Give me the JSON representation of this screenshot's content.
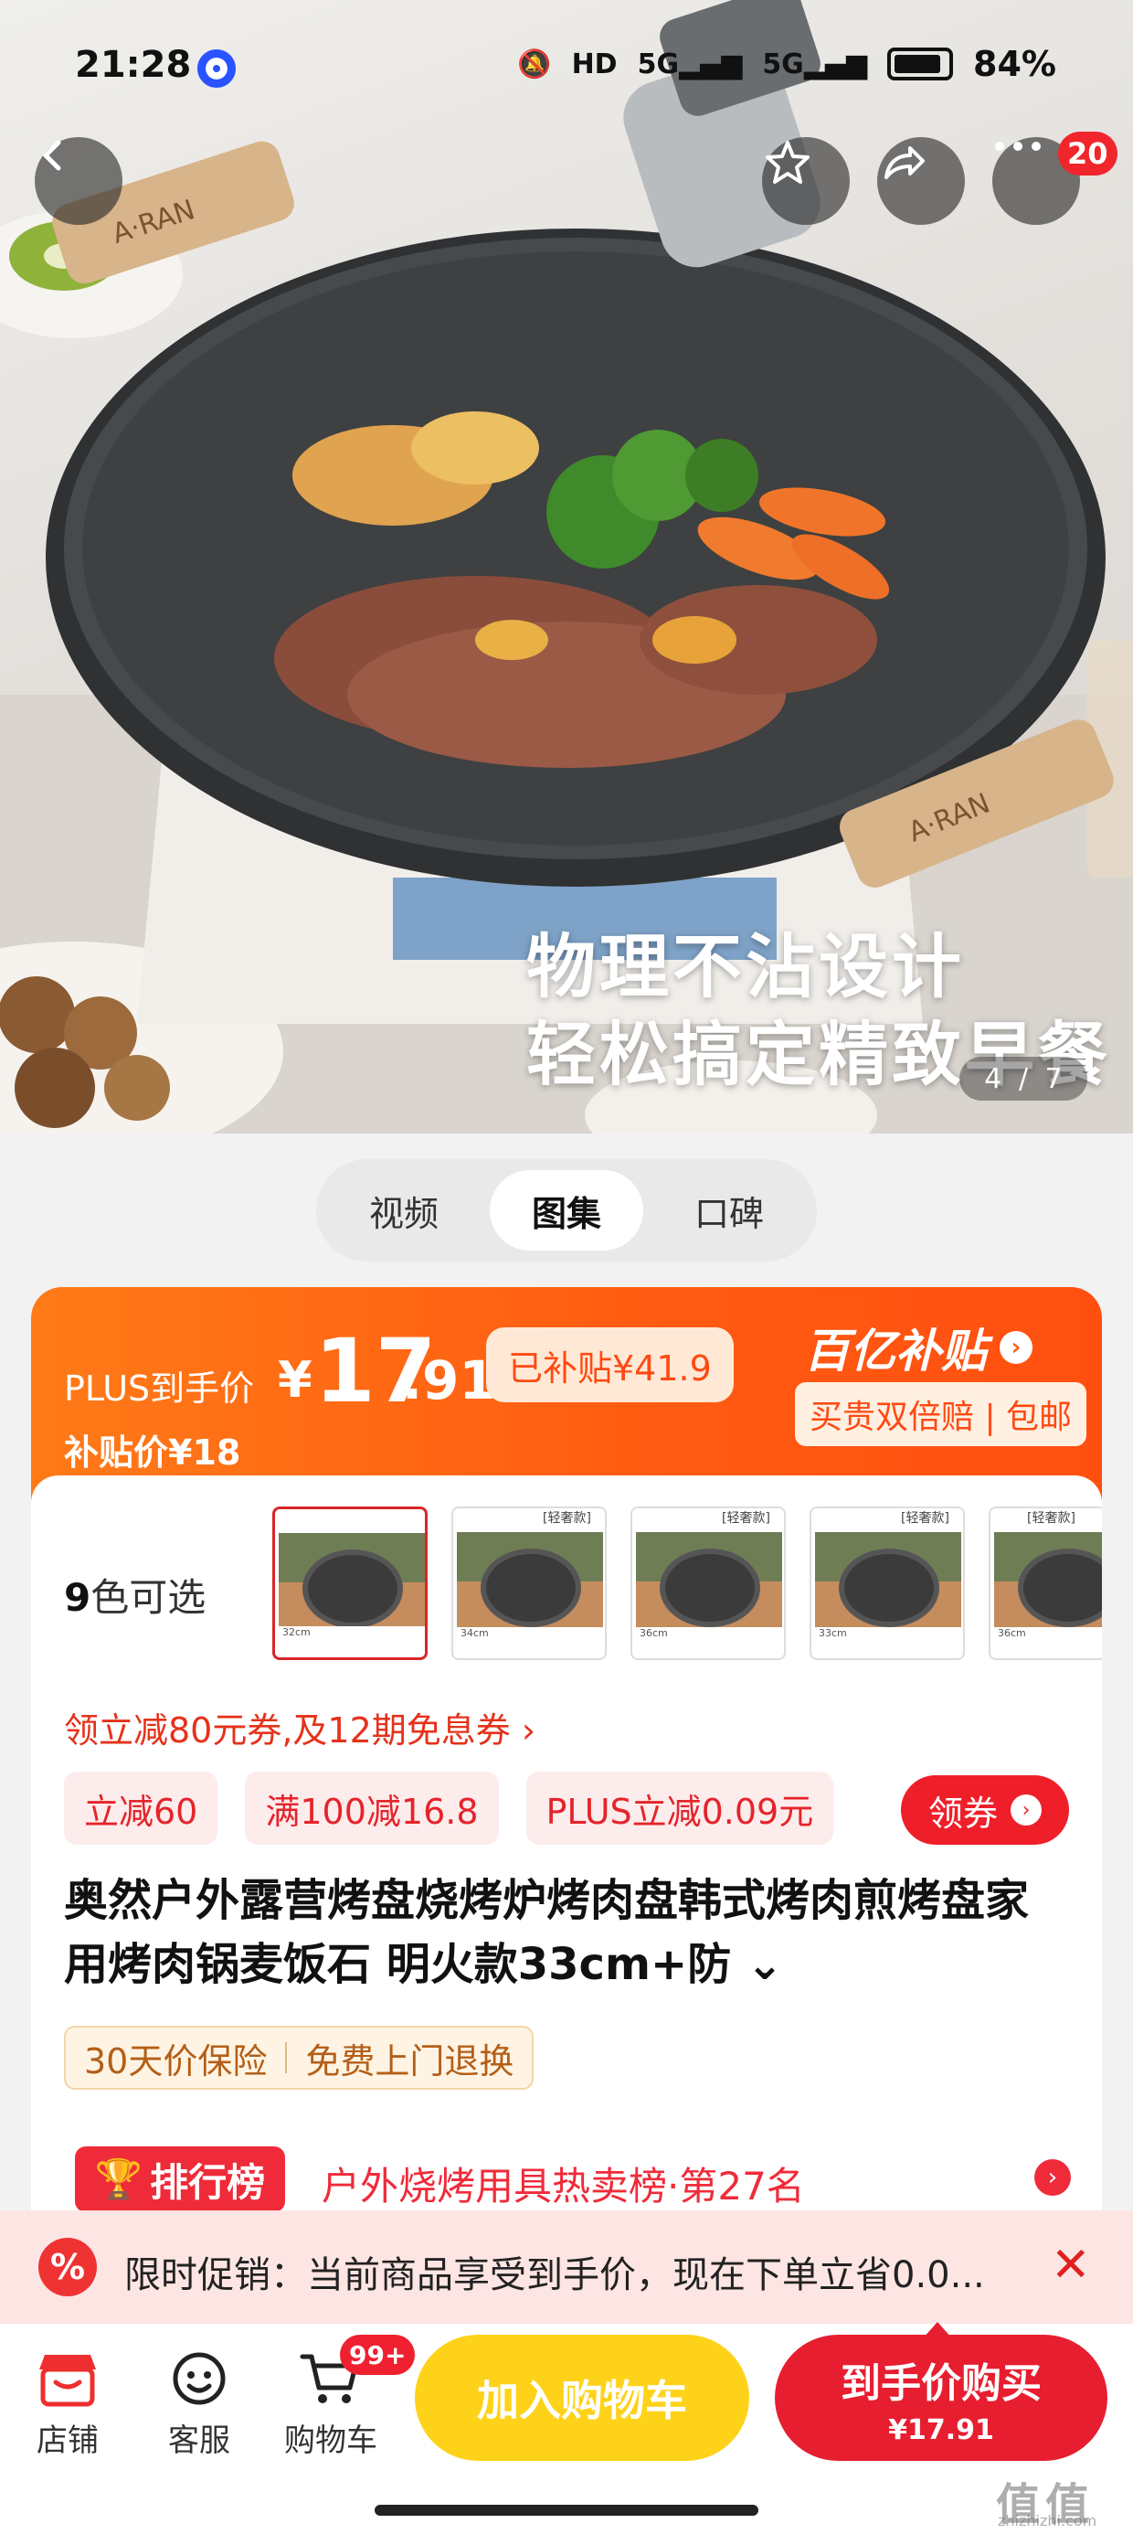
{
  "status_bar": {
    "time": "21:28",
    "hd": "HD",
    "net1": "5G",
    "net2": "5G",
    "battery": "84%"
  },
  "hero": {
    "caption_line1": "物理不沾设计",
    "caption_line2": "轻松搞定精致早餐",
    "brand_text": "A·RAN",
    "more_badge": "20",
    "page_current": "4",
    "page_total": "7"
  },
  "media_tabs": [
    "视频",
    "图集",
    "口碑"
  ],
  "price": {
    "plus_label": "PLUS到手价",
    "currency": "¥",
    "integer": "17",
    "decimal": ".91",
    "subsidy_chip": "已补贴¥41.9",
    "subsidy_price": "补贴价¥18",
    "yi_logo": "百亿补贴",
    "yi_sub": "买贵双倍赔 | 包邮"
  },
  "colors": {
    "count_num": "9",
    "count_label": "色可选",
    "swatch_tag": "[轻奢款]",
    "swatches": [
      "32cm",
      "34cm",
      "36cm",
      "33cm",
      "36cm"
    ]
  },
  "coupon_line": "领立减80元券,及12期免息券 ›",
  "tags": [
    "立减60",
    "满100减16.8",
    "PLUS立减0.09元"
  ],
  "coupon_button": "领券",
  "title": "奥然户外露营烤盘烧烤炉烤肉盘韩式烤肉煎烤盘家用烤肉锅麦饭石 明火款33cm+防 ⌄",
  "guarantees": [
    "30天价保险",
    "免费上门退换"
  ],
  "rank": {
    "badge": "排行榜",
    "text": "户外烧烤用具热卖榜·第27名"
  },
  "promo": {
    "icon": "%",
    "text": "限时促销：当前商品享受到手价，现在下单立省0.0..."
  },
  "bottom_nav": [
    {
      "label": "店铺",
      "icon": "store-icon"
    },
    {
      "label": "客服",
      "icon": "service-icon"
    },
    {
      "label": "购物车",
      "icon": "cart-icon",
      "badge": "99+"
    }
  ],
  "add_cart_label": "加入购物车",
  "buy_now": {
    "line1": "到手价购买",
    "line2": "¥17.91"
  },
  "watermark": {
    "main": "值值值",
    "sub": "zhizhizhi.com"
  },
  "theme": {
    "accent_orange": "#ff5a12",
    "accent_red": "#e71e30",
    "cart_yellow": "#ffd21a"
  }
}
